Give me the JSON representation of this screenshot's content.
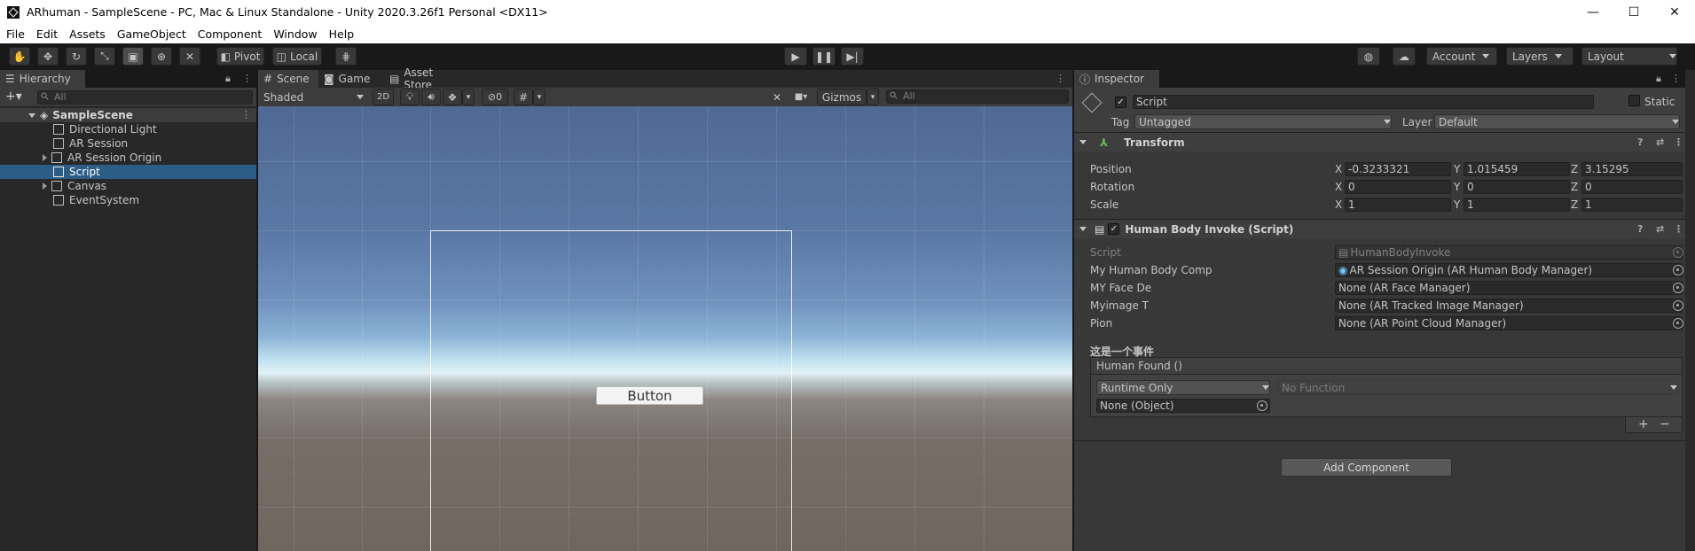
{
  "window": {
    "title": "ARhuman - SampleScene - PC, Mac & Linux Standalone - Unity 2020.3.26f1 Personal <DX11>"
  },
  "menu": [
    "File",
    "Edit",
    "Assets",
    "GameObject",
    "Component",
    "Window",
    "Help"
  ],
  "toolbar": {
    "pivot": "Pivot",
    "local": "Local",
    "account": "Account",
    "layers": "Layers",
    "layout": "Layout"
  },
  "hierarchy": {
    "tab": "Hierarchy",
    "search_placeholder": "All",
    "scene": "SampleScene",
    "items": [
      "Directional Light",
      "AR Session",
      "AR Session Origin",
      "Script",
      "Canvas",
      "EventSystem"
    ]
  },
  "scene": {
    "tabs": [
      "Scene",
      "Game",
      "Asset Store"
    ],
    "shading": "Shaded",
    "mode2d": "2D",
    "hidden_count": "0",
    "gizmos": "Gizmos",
    "search_placeholder": "All",
    "button_label": "Button"
  },
  "inspector": {
    "tab": "Inspector",
    "object_name": "Script",
    "static_label": "Static",
    "tag_label": "Tag",
    "tag_value": "Untagged",
    "layer_label": "Layer",
    "layer_value": "Default",
    "transform": {
      "title": "Transform",
      "position": {
        "label": "Position",
        "x": "-0.3233321",
        "y": "1.015459",
        "z": "3.15295"
      },
      "rotation": {
        "label": "Rotation",
        "x": "0",
        "y": "0",
        "z": "0"
      },
      "scale": {
        "label": "Scale",
        "x": "1",
        "y": "1",
        "z": "1"
      },
      "axes": [
        "X",
        "Y",
        "Z"
      ]
    },
    "component": {
      "title": "Human Body Invoke (Script)",
      "fields": [
        {
          "label": "Script",
          "value": "HumanBodyInvoke"
        },
        {
          "label": "My Human Body Comp",
          "value": "AR Session Origin (AR Human Body Manager)"
        },
        {
          "label": "MY Face De",
          "value": "None (AR Face Manager)"
        },
        {
          "label": "Myimage T",
          "value": "None (AR Tracked Image Manager)"
        },
        {
          "label": "Pion",
          "value": "None (AR Point Cloud Manager)"
        }
      ],
      "event_header": "这是一个事件",
      "event_name": "Human Found ()",
      "runtime": "Runtime Only",
      "function": "No Function",
      "object": "None (Object)",
      "plus": "+",
      "minus": "−"
    },
    "add_component": "Add Component"
  }
}
